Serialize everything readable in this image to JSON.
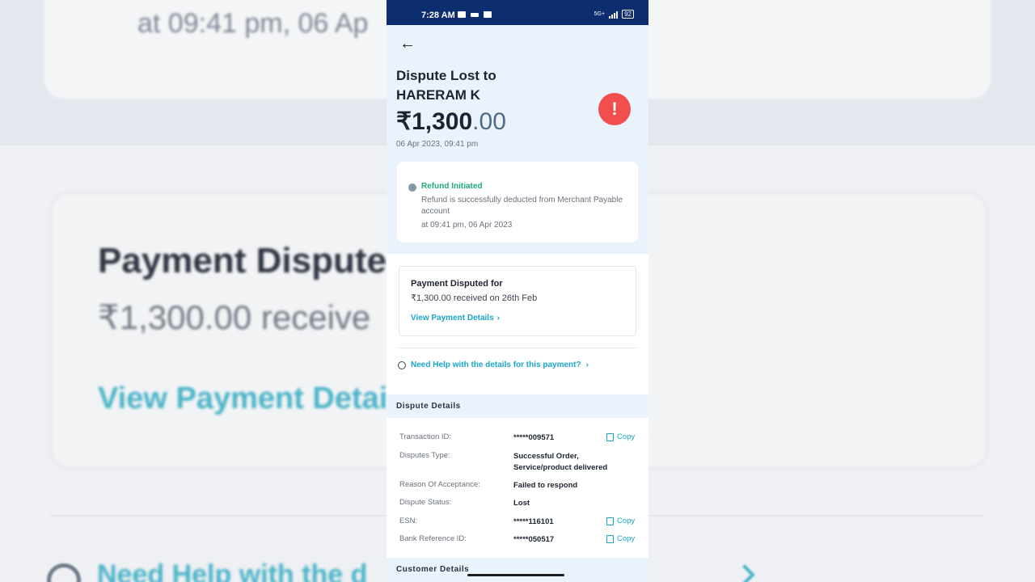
{
  "background": {
    "top_snippet": "at 09:41 pm, 06 Ap",
    "card_heading": "Payment Disputed",
    "card_sub": "₹1,300.00 receive",
    "card_link": "View Payment Details",
    "help_link": "Need Help with the d"
  },
  "statusbar": {
    "time": "7:28 AM",
    "network": "5G+",
    "battery": "92"
  },
  "header": {
    "back_icon": "arrow-left-icon",
    "title": "Dispute Lost to HARERAM K",
    "amount_main": "₹1,300",
    "amount_decimal": ".00",
    "date": "06 Apr 2023, 09:41 pm",
    "alert_icon": "!",
    "alert_color": "#f24e4e"
  },
  "timeline": {
    "title": "Refund Initiated",
    "description": "Refund is successfully deducted from Merchant Payable account",
    "time": "at 09:41 pm, 06 Apr 2023"
  },
  "payment_card": {
    "heading": "Payment Disputed for",
    "subtitle": "₹1,300.00 received on 26th Feb",
    "link": "View Payment Details"
  },
  "help": {
    "text": "Need Help with the details for this payment?"
  },
  "dispute_details": {
    "section_title": "Dispute Details",
    "rows": [
      {
        "label": "Transaction ID:",
        "value": "*****009571",
        "copy": "Copy"
      },
      {
        "label": "Disputes Type:",
        "value": "Successful Order, Service/product delivered"
      },
      {
        "label": "Reason Of Acceptance:",
        "value": "Failed to respond"
      },
      {
        "label": "Dispute Status:",
        "value": "Lost"
      },
      {
        "label": "ESN:",
        "value": "*****116101",
        "copy": "Copy"
      },
      {
        "label": "Bank Reference ID:",
        "value": "*****050517",
        "copy": "Copy"
      }
    ]
  },
  "customer_details": {
    "section_title": "Customer Details"
  },
  "colors": {
    "accent": "#1ba6c9",
    "success": "#1fa97a",
    "statusbar": "#0c2d6e",
    "hero_bg": "#eaf2fb"
  }
}
